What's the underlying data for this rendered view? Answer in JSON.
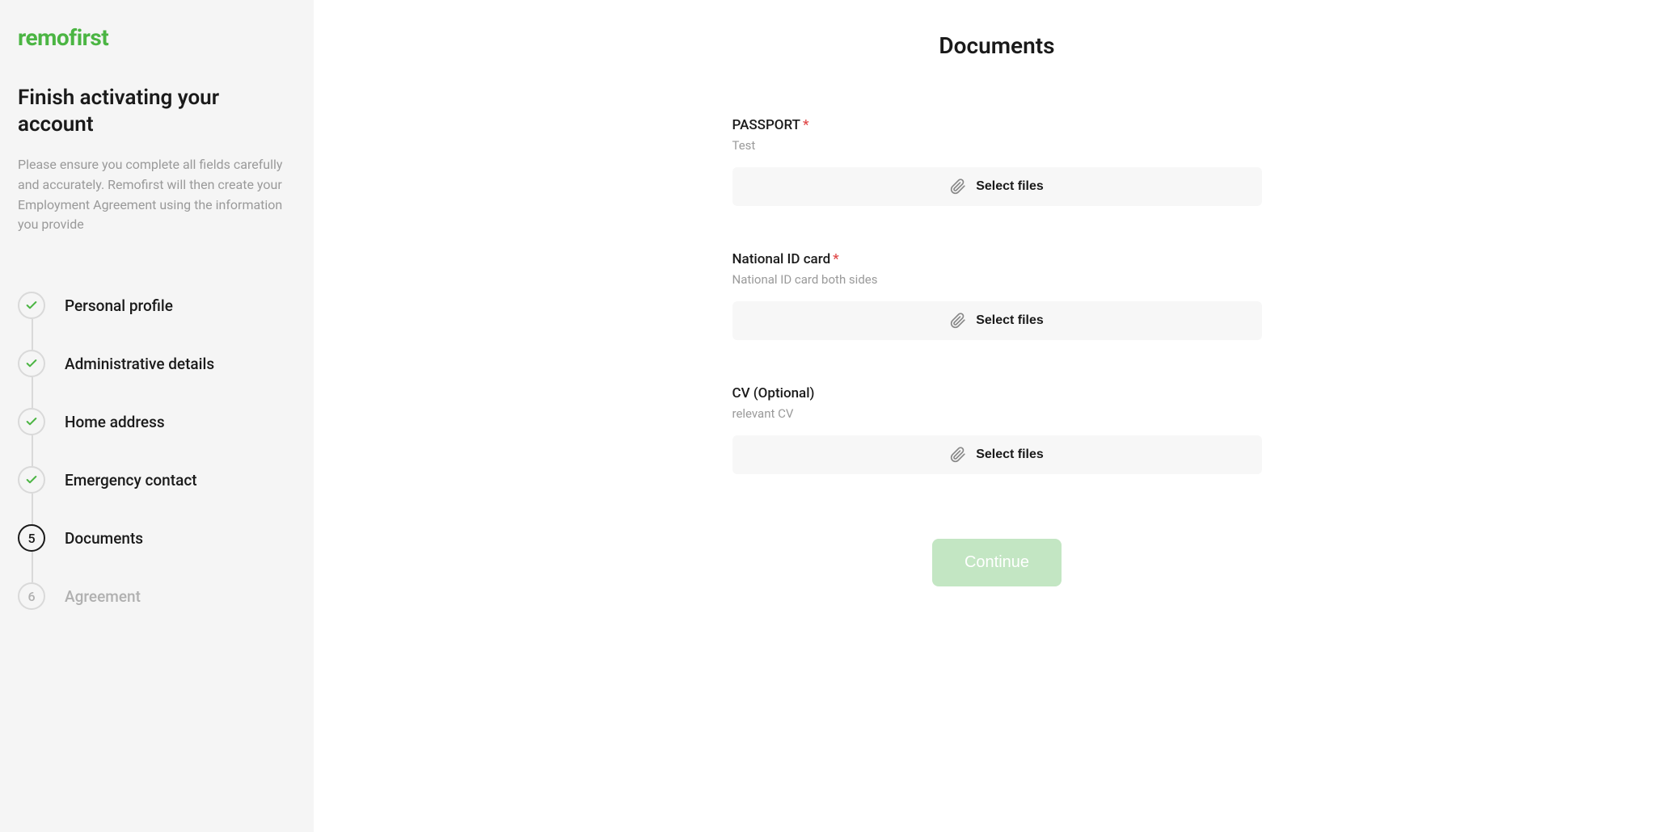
{
  "brand": "remofirst",
  "sidebar": {
    "title": "Finish activating your account",
    "description": "Please ensure you complete all fields carefully and accurately. Remofirst will then create your Employment Agreement using the information you provide"
  },
  "steps": [
    {
      "label": "Personal profile",
      "state": "done"
    },
    {
      "label": "Administrative details",
      "state": "done"
    },
    {
      "label": "Home address",
      "state": "done"
    },
    {
      "label": "Emergency contact",
      "state": "done"
    },
    {
      "label": "Documents",
      "state": "current",
      "number": "5"
    },
    {
      "label": "Agreement",
      "state": "pending",
      "number": "6"
    }
  ],
  "page": {
    "title": "Documents",
    "select_files_label": "Select files",
    "continue_label": "Continue"
  },
  "fields": [
    {
      "label": "PASSPORT",
      "required": true,
      "description": "Test"
    },
    {
      "label": "National ID card",
      "required": true,
      "description": "National ID card both sides"
    },
    {
      "label": "CV (Optional)",
      "required": false,
      "description": "relevant CV"
    }
  ]
}
